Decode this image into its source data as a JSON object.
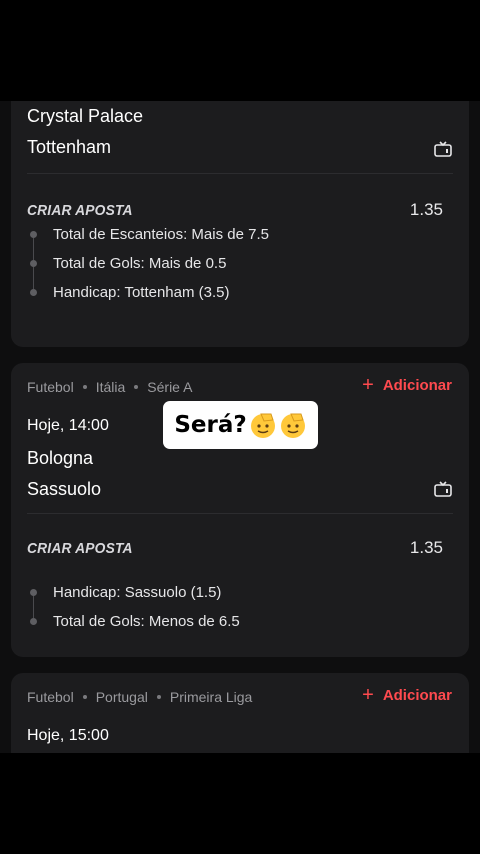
{
  "overlay": {
    "text": "Será?",
    "emoji_icon": "saluting-face-emoji"
  },
  "colors": {
    "accent": "#ff4a4f",
    "card_bg": "#1c1c1e",
    "page_bg": "#0e0e0f"
  },
  "bets": [
    {
      "team_home": "Crystal Palace",
      "team_away": "Tottenham",
      "tv_icon": "tv-icon",
      "create_label": "CRIAR APOSTA",
      "odds": "1.35",
      "selections": [
        "Total de Escanteios: Mais de 7.5",
        "Total de Gols: Mais de 0.5",
        "Handicap: Tottenham (3.5)"
      ]
    },
    {
      "sport": "Futebol",
      "country": "Itália",
      "league": "Série A",
      "add_label": "Adicionar",
      "time": "Hoje, 14:00",
      "team_home": "Bologna",
      "team_away": "Sassuolo",
      "tv_icon": "tv-icon",
      "create_label": "CRIAR APOSTA",
      "odds": "1.35",
      "selections": [
        "Handicap: Sassuolo (1.5)",
        "Total de Gols: Menos de 6.5"
      ]
    },
    {
      "sport": "Futebol",
      "country": "Portugal",
      "league": "Primeira Liga",
      "add_label": "Adicionar",
      "time": "Hoje, 15:00"
    }
  ]
}
